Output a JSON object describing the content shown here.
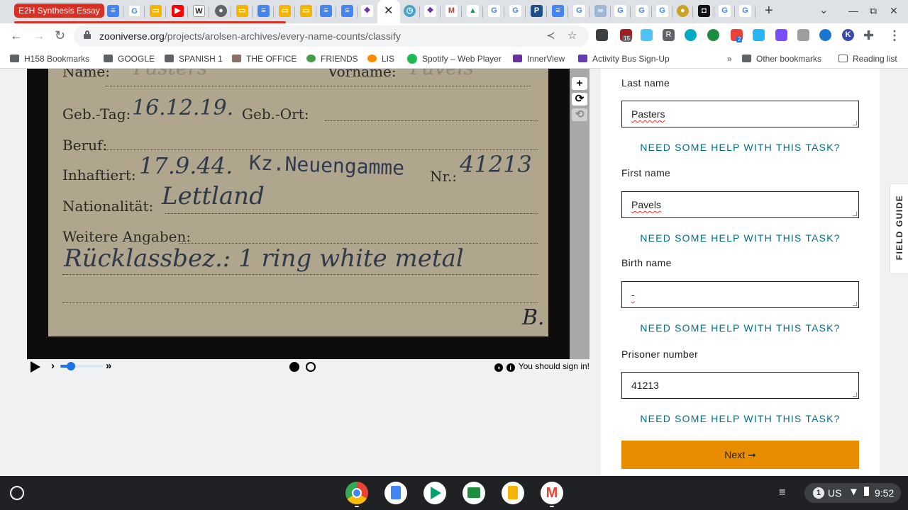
{
  "browser": {
    "tab_group_label": "E2H Synthesis Essay",
    "url_host": "zooniverse.org",
    "url_path": "/projects/arolsen-archives/every-name-counts/classify",
    "extension_badges": {
      "counter": "15",
      "notif": "2"
    },
    "bookmarks": [
      {
        "label": "H158 Bookmarks"
      },
      {
        "label": "GOOGLE"
      },
      {
        "label": "SPANISH 1"
      },
      {
        "label": "THE OFFICE"
      },
      {
        "label": "FRIENDS"
      },
      {
        "label": "LIS"
      },
      {
        "label": "Spotify – Web Player"
      },
      {
        "label": "InnerView"
      },
      {
        "label": "Activity Bus Sign-Up"
      },
      {
        "label": "»"
      },
      {
        "label": "Other bookmarks"
      },
      {
        "label": "Reading list"
      }
    ]
  },
  "card": {
    "name_label": "Name:",
    "vorname_label": "Vorname:",
    "name_value": "Pasters",
    "vorname_value": "Pavels",
    "geb_tag_label": "Geb.-Tag:",
    "geb_tag_value": "16.12.19.",
    "geb_ort_label": "Geb.-Ort:",
    "beruf_label": "Beruf:",
    "inhaftiert_label": "Inhaftiert:",
    "inhaftiert_value": "17.9.44.",
    "camp_stamp": "Kz.Neuengamme",
    "nr_label": "Nr.:",
    "nr_value": "41213",
    "nationalitaet_label": "Nationalität:",
    "nationalitaet_value": "Lettland",
    "weitere_label": "Weitere Angaben:",
    "weitere_value": "Rücklassbez.: 1 ring white metal",
    "initial": "B."
  },
  "viewer": {
    "tools": [
      "+",
      "⟳",
      "⟲"
    ],
    "slider_value": 0.25,
    "signin_text": "You should sign in!"
  },
  "task": {
    "questions": [
      {
        "label": "Last name",
        "value": "Pasters"
      },
      {
        "label": "First name",
        "value": "Pavels"
      },
      {
        "label": "Birth name",
        "value": "-"
      },
      {
        "label": "Prisoner number",
        "value": "41213"
      }
    ],
    "help_text": "NEED SOME HELP WITH THIS TASK?",
    "next_label": "Next ➞",
    "field_guide_label": "FIELD GUIDE"
  },
  "shelf": {
    "locale": "US",
    "notification_count": "1",
    "time": "9:52"
  },
  "colors": {
    "accent_orange": "#e88d00",
    "help_teal": "#00707e",
    "tab_group_red": "#d93025"
  }
}
